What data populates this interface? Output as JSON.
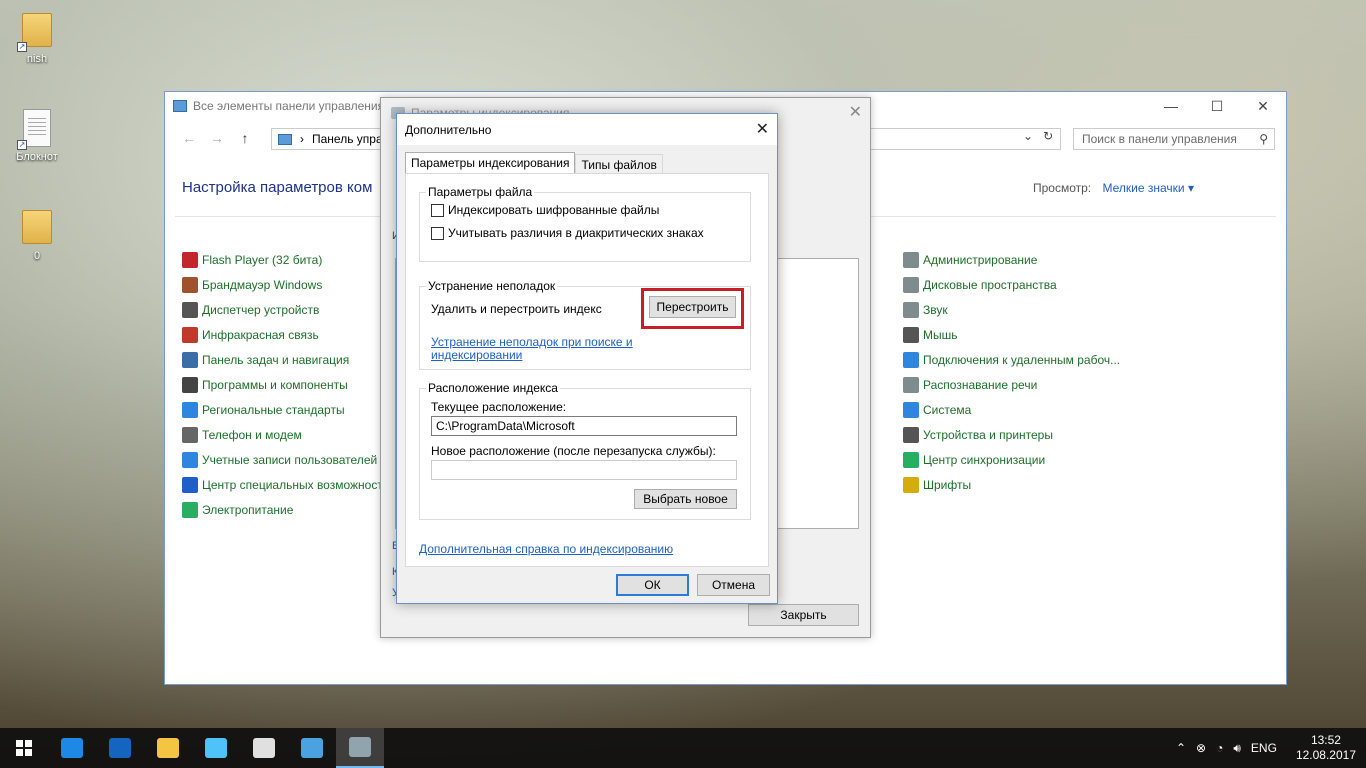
{
  "desktop": {
    "icons": [
      {
        "label": "nish"
      },
      {
        "label": "Блокнот"
      },
      {
        "label": "0"
      }
    ]
  },
  "control_panel": {
    "title": "Все элементы панели управления",
    "address": "Панель упра",
    "search_placeholder": "Поиск в панели управления",
    "heading": "Настройка параметров ком",
    "view_by_label": "Просмотр:",
    "view_by_value": "Мелкие значки",
    "left_items": [
      {
        "label": "Flash Player (32 бита)",
        "icon": "flash-icon",
        "color": "#c1272d"
      },
      {
        "label": "Брандмауэр Windows",
        "icon": "firewall-icon",
        "color": "#a0522d"
      },
      {
        "label": "Диспетчер устройств",
        "icon": "device-manager-icon",
        "color": "#555555"
      },
      {
        "label": "Инфракрасная связь",
        "icon": "infrared-icon",
        "color": "#c0392b"
      },
      {
        "label": "Панель задач и навигация",
        "icon": "taskbar-icon",
        "color": "#3a6ea5"
      },
      {
        "label": "Программы и компоненты",
        "icon": "programs-icon",
        "color": "#444444"
      },
      {
        "label": "Региональные стандарты",
        "icon": "region-icon",
        "color": "#2e86de"
      },
      {
        "label": "Телефон и модем",
        "icon": "phone-icon",
        "color": "#666666"
      },
      {
        "label": "Учетные записи пользователей",
        "icon": "users-icon",
        "color": "#2e86de"
      },
      {
        "label": "Центр специальных возможност",
        "icon": "accessibility-icon",
        "color": "#1e60c8"
      },
      {
        "label": "Электропитание",
        "icon": "power-icon",
        "color": "#27ae60"
      }
    ],
    "right_items": [
      {
        "label": "Администрирование",
        "icon": "admin-icon",
        "color": "#7f8c8d"
      },
      {
        "label": "Дисковые пространства",
        "icon": "storage-icon",
        "color": "#7f8c8d"
      },
      {
        "label": "Звук",
        "icon": "sound-icon",
        "color": "#7f8c8d"
      },
      {
        "label": "Мышь",
        "icon": "mouse-icon",
        "color": "#555555"
      },
      {
        "label": "Подключения к удаленным рабоч...",
        "icon": "remote-icon",
        "color": "#2e86de"
      },
      {
        "label": "Распознавание речи",
        "icon": "microphone-icon",
        "color": "#7f8c8d"
      },
      {
        "label": "Система",
        "icon": "system-icon",
        "color": "#2e86de"
      },
      {
        "label": "Устройства и принтеры",
        "icon": "printer-icon",
        "color": "#555555"
      },
      {
        "label": "Центр синхронизации",
        "icon": "sync-icon",
        "color": "#27ae60"
      },
      {
        "label": "Шрифты",
        "icon": "fonts-icon",
        "color": "#d4ac0d"
      }
    ]
  },
  "indexing_window": {
    "title": "Параметры индексирования",
    "close_label": "Закрыть"
  },
  "advanced_dialog": {
    "title": "Дополнительно",
    "tabs": [
      {
        "label": "Параметры индексирования",
        "active": true
      },
      {
        "label": "Типы файлов",
        "active": false
      }
    ],
    "file_settings": {
      "legend": "Параметры файла",
      "index_encrypted": "Индексировать шифрованные файлы",
      "diacritics": "Учитывать различия в диакритических знаках"
    },
    "troubleshooting": {
      "legend": "Устранение неполадок",
      "rebuild_text": "Удалить и перестроить индекс",
      "rebuild_button": "Перестроить",
      "link_line1": "Устранение неполадок при поиске и",
      "link_line2": "индексировании"
    },
    "index_location": {
      "legend": "Расположение индекса",
      "current_label": "Текущее расположение:",
      "current_value": "C:\\ProgramData\\Microsoft",
      "new_label": "Новое расположение (после перезапуска службы):",
      "new_value": "",
      "select_button": "Выбрать новое"
    },
    "help_link": "Дополнительная справка по индексированию",
    "ok_button": "ОК",
    "cancel_button": "Отмена"
  },
  "taskbar": {
    "apps": [
      {
        "icon": "edge-icon",
        "color": "#1e88e5"
      },
      {
        "icon": "browser-icon",
        "color": "#1565c0"
      },
      {
        "icon": "explorer-icon",
        "color": "#f4c542"
      },
      {
        "icon": "notepad-icon",
        "color": "#4fc3f7"
      },
      {
        "icon": "paint-icon",
        "color": "#e0e0e0"
      },
      {
        "icon": "control-panel-icon",
        "color": "#4aa3df"
      },
      {
        "icon": "indexing-icon",
        "color": "#90a4ae"
      }
    ],
    "language": "ENG",
    "time": "13:52",
    "date": "12.08.2017"
  }
}
